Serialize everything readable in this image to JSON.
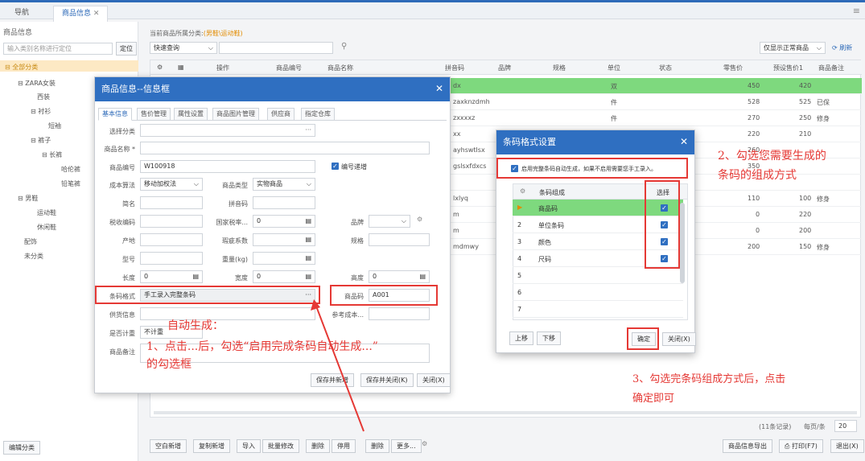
{
  "tabs": [
    {
      "label": "导航"
    },
    {
      "label": "商品信息"
    }
  ],
  "left": {
    "title": "商品信息",
    "search_placeholder": "输入类别名称进行定位",
    "locate_label": "定位",
    "tree": [
      "全部分类",
      "ZARA女装",
      "西装",
      "衬衫",
      "短袖",
      "裤子",
      "长裤",
      "哈伦裤",
      "铅笔裤",
      "男鞋",
      "运动鞋",
      "休闲鞋",
      "配饰",
      "未分类"
    ],
    "edit_category_label": "编辑分类"
  },
  "toolbar": {
    "category_prompt": "当前商品所属分类:",
    "category_value": "(男鞋\\运动鞋)",
    "search_mode": "快速查询",
    "filter_label": "仅显示正常商品",
    "refresh_label": "刷新"
  },
  "grid": {
    "headers": [
      "操作",
      "商品编号",
      "商品名称",
      "拼音码",
      "品牌",
      "规格",
      "单位",
      "状态",
      "零售价",
      "预设售价1",
      "商品备注"
    ],
    "rows": [
      {
        "pinyin": "dx",
        "unit": "双",
        "price": "450",
        "preset": "420",
        "note": ""
      },
      {
        "pinyin": "zaxknzdmh",
        "unit": "件",
        "price": "528",
        "preset": "525",
        "note": "已保"
      },
      {
        "pinyin": "zxxxxz",
        "unit": "件",
        "price": "270",
        "preset": "250",
        "note": "修身"
      },
      {
        "pinyin": "xx",
        "unit": "",
        "price": "220",
        "preset": "210",
        "note": ""
      },
      {
        "pinyin": "ayhswtlsx",
        "unit": "",
        "price": "260",
        "preset": "",
        "note": ""
      },
      {
        "pinyin": "gslsxfdxcs",
        "unit": "",
        "price": "350",
        "preset": "",
        "note": ""
      },
      {
        "pinyin": "",
        "unit": "",
        "price": "",
        "preset": "",
        "note": ""
      },
      {
        "pinyin": "lxlyq",
        "unit": "",
        "price": "110",
        "preset": "100",
        "note": "修身"
      },
      {
        "pinyin": "m",
        "unit": "",
        "price": "0",
        "preset": "220",
        "note": ""
      },
      {
        "pinyin": "m",
        "unit": "",
        "price": "0",
        "preset": "200",
        "note": ""
      },
      {
        "pinyin": "mdmwy",
        "unit": "",
        "price": "200",
        "preset": "150",
        "note": "修身"
      }
    ],
    "footer_count": "(11条记录)",
    "per_page_label": "每页/条",
    "per_page": "20"
  },
  "bottombar": [
    "空白新增",
    "复制新增",
    "导入",
    "批量修改",
    "删除",
    "停用",
    "删除",
    "更多..."
  ],
  "bottomright": [
    "商品信息导出",
    "打印(F7)",
    "退出(X)"
  ],
  "dialog1": {
    "title": "商品信息--信息框",
    "tabs": [
      "基本信息",
      "售价管理",
      "属性设置",
      "商品图片管理",
      "供应商",
      "指定仓库"
    ],
    "fields": {
      "category": "选择分类",
      "name": "商品名称 *",
      "code_label": "商品编号",
      "code_value": "W100918",
      "auto_code": "编号递增",
      "cost_label": "成本算法",
      "cost_value": "移动加权法",
      "type_label": "商品类型",
      "type_value": "实物商品",
      "short_label": "简名",
      "pinyin_label": "拼音码",
      "tax_label": "税收编码",
      "taxrate_label": "国家税率...",
      "taxrate_value": "0",
      "brand_label": "品牌",
      "origin_label": "产地",
      "shrink_label": "瑕疵系数",
      "spec_label": "规格",
      "model_label": "型号",
      "weight_label": "重量(kg)",
      "length_label": "长度",
      "length_value": "0",
      "width_label": "宽度",
      "width_value": "0",
      "height_label": "高度",
      "height_value": "0",
      "barcode_label": "条码格式",
      "barcode_value": "手工录入完整条码",
      "goodscode_label": "商品码",
      "goodscode_value": "A001",
      "supplier_label": "供货信息",
      "refcost_label": "参考成本...",
      "measure_label": "是否计重",
      "measure_value": "不计重",
      "remark_label": "商品备注"
    },
    "buttons": [
      "保存并新增",
      "保存并关闭(K)",
      "关闭(X)"
    ]
  },
  "dialog2": {
    "title": "条码格式设置",
    "enable_text": "启用完整条码自动生成，如果不启用需要您手工录入。",
    "col_compose": "条码组成",
    "col_select": "选择",
    "rows": [
      {
        "n": "",
        "name": "商品码",
        "checked": true
      },
      {
        "n": "2",
        "name": "单位条码",
        "checked": true
      },
      {
        "n": "3",
        "name": "颜色",
        "checked": true
      },
      {
        "n": "4",
        "name": "尺码",
        "checked": true
      },
      {
        "n": "5",
        "name": "",
        "checked": false
      },
      {
        "n": "6",
        "name": "",
        "checked": false
      },
      {
        "n": "7",
        "name": "",
        "checked": false
      }
    ],
    "up": "上移",
    "down": "下移",
    "ok": "确定",
    "close": "关闭(X)"
  },
  "annotations": {
    "a1_title": "自动生成：",
    "a1_line1": "1、点击...后，勾选“启用完成条码自动生成...”",
    "a1_line2": "的勾选框",
    "a2_line1": "2、勾选您需要生成的",
    "a2_line2": "条码的组成方式",
    "a3_line1": "3、勾选完条码组成方式后，点击",
    "a3_line2": "确定即可"
  },
  "colors": {
    "accent": "#2f6fc1",
    "highlight": "#7ed97e",
    "annotation": "#e53935"
  }
}
